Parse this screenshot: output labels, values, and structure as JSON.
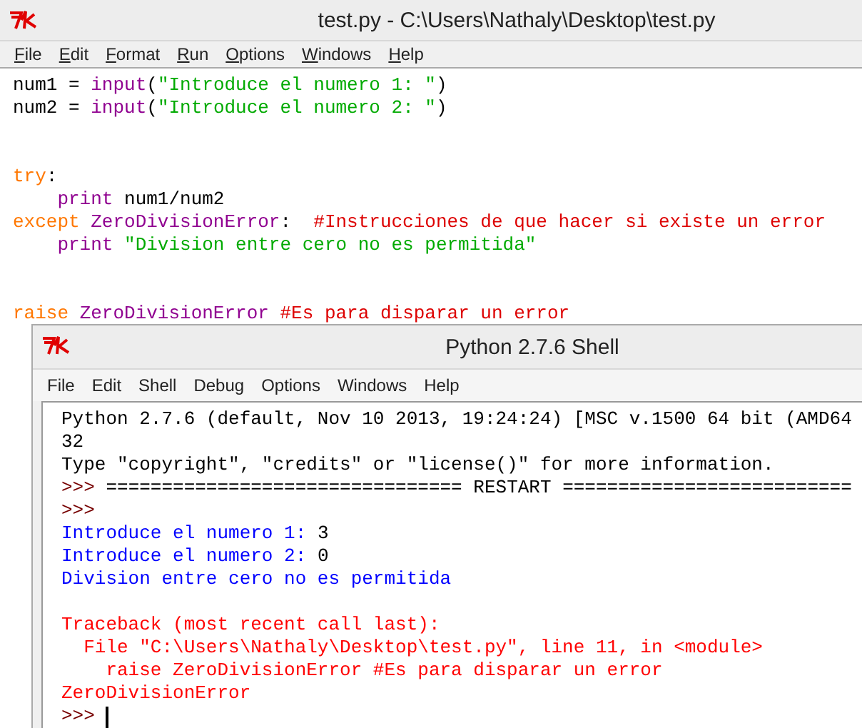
{
  "editor": {
    "title": "test.py - C:\\Users\\Nathaly\\Desktop\\test.py",
    "menu": [
      "File",
      "Edit",
      "Format",
      "Run",
      "Options",
      "Windows",
      "Help"
    ],
    "lines": [
      {
        "kind": "code",
        "segments": [
          {
            "kind": "plain",
            "text": "num1 = "
          },
          {
            "kind": "builtin",
            "text": "input"
          },
          {
            "kind": "plain",
            "text": "("
          },
          {
            "kind": "string",
            "text": "\"Introduce el numero 1: \""
          },
          {
            "kind": "plain",
            "text": ")"
          }
        ]
      },
      {
        "kind": "code",
        "segments": [
          {
            "kind": "plain",
            "text": "num2 = "
          },
          {
            "kind": "builtin",
            "text": "input"
          },
          {
            "kind": "plain",
            "text": "("
          },
          {
            "kind": "string",
            "text": "\"Introduce el numero 2: \""
          },
          {
            "kind": "plain",
            "text": ")"
          }
        ]
      },
      {
        "kind": "blank"
      },
      {
        "kind": "blank"
      },
      {
        "kind": "code",
        "segments": [
          {
            "kind": "keyword",
            "text": "try"
          },
          {
            "kind": "plain",
            "text": ":"
          }
        ]
      },
      {
        "kind": "code",
        "segments": [
          {
            "kind": "builtin",
            "text": "    print"
          },
          {
            "kind": "plain",
            "text": " num1/num2"
          }
        ]
      },
      {
        "kind": "code",
        "segments": [
          {
            "kind": "keyword",
            "text": "except "
          },
          {
            "kind": "builtin",
            "text": "ZeroDivisionError"
          },
          {
            "kind": "plain",
            "text": ":  "
          },
          {
            "kind": "comment",
            "text": "#Instrucciones de que hacer si existe un error"
          }
        ]
      },
      {
        "kind": "code",
        "segments": [
          {
            "kind": "builtin",
            "text": "    print"
          },
          {
            "kind": "string",
            "text": " \"Division entre cero no es permitida\""
          }
        ]
      },
      {
        "kind": "blank"
      },
      {
        "kind": "blank"
      },
      {
        "kind": "code",
        "segments": [
          {
            "kind": "keyword",
            "text": "raise "
          },
          {
            "kind": "builtin",
            "text": "ZeroDivisionError "
          },
          {
            "kind": "comment",
            "text": "#Es para disparar un error"
          }
        ]
      }
    ]
  },
  "shell": {
    "title": "Python 2.7.6 Shell",
    "menu": [
      "File",
      "Edit",
      "Shell",
      "Debug",
      "Options",
      "Windows",
      "Help"
    ],
    "lines": [
      {
        "kind": "code",
        "segments": [
          {
            "kind": "plain",
            "text": "Python 2.7.6 (default, Nov 10 2013, 19:24:24) [MSC v.1500 64 bit (AMD64"
          }
        ]
      },
      {
        "kind": "code",
        "segments": [
          {
            "kind": "plain",
            "text": "32"
          }
        ]
      },
      {
        "kind": "code",
        "segments": [
          {
            "kind": "plain",
            "text": "Type \"copyright\", \"credits\" or \"license()\" for more information."
          }
        ]
      },
      {
        "kind": "code",
        "segments": [
          {
            "kind": "prompt",
            "text": ">>> "
          },
          {
            "kind": "plain",
            "text": "================================ RESTART =========================="
          }
        ]
      },
      {
        "kind": "code",
        "segments": [
          {
            "kind": "prompt",
            "text": ">>>"
          }
        ]
      },
      {
        "kind": "code",
        "segments": [
          {
            "kind": "stdout",
            "text": "Introduce el numero 1: "
          },
          {
            "kind": "plain",
            "text": "3"
          }
        ]
      },
      {
        "kind": "code",
        "segments": [
          {
            "kind": "stdout",
            "text": "Introduce el numero 2: "
          },
          {
            "kind": "plain",
            "text": "0"
          }
        ]
      },
      {
        "kind": "code",
        "segments": [
          {
            "kind": "stdout",
            "text": "Division entre cero no es permitida"
          }
        ]
      },
      {
        "kind": "blank"
      },
      {
        "kind": "code",
        "segments": [
          {
            "kind": "stderr",
            "text": "Traceback (most recent call last):"
          }
        ]
      },
      {
        "kind": "code",
        "segments": [
          {
            "kind": "stderr",
            "text": "  File \"C:\\Users\\Nathaly\\Desktop\\test.py\", line 11, in <module>"
          }
        ]
      },
      {
        "kind": "code",
        "segments": [
          {
            "kind": "stderr",
            "text": "    raise ZeroDivisionError #Es para disparar un error"
          }
        ]
      },
      {
        "kind": "code",
        "segments": [
          {
            "kind": "stderr",
            "text": "ZeroDivisionError"
          }
        ]
      },
      {
        "kind": "prompt",
        "segments": [
          {
            "kind": "prompt",
            "text": ">>> "
          }
        ]
      }
    ]
  }
}
